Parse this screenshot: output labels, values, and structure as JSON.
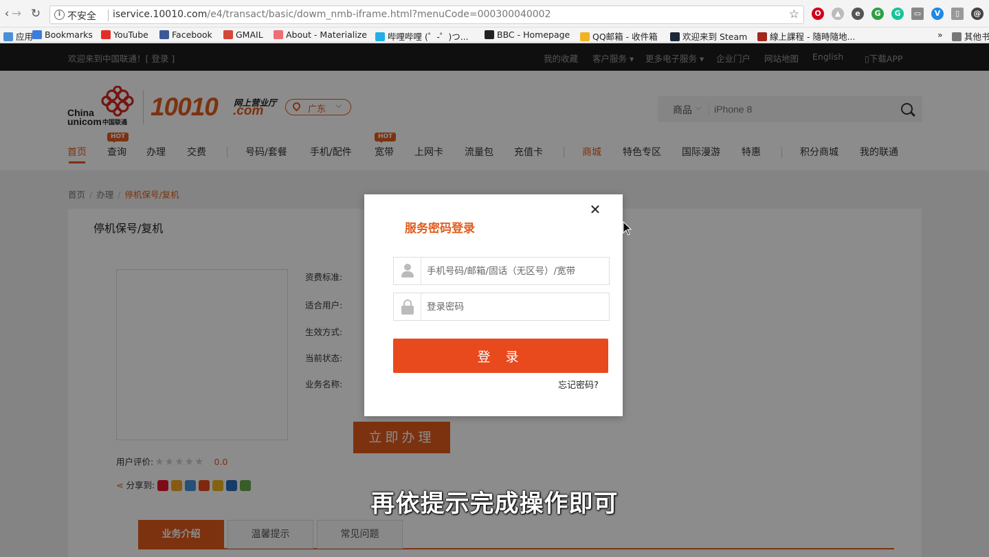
{
  "browser": {
    "insecure_label": "不安全",
    "url_host": "iservice.10010.com",
    "url_path": "/e4/transact/basic/dowm_nmb-iframe.html?menuCode=000300040002",
    "bookmarks": [
      {
        "label": "应用",
        "icon": "apps-icon",
        "color": "#4a90d9"
      },
      {
        "label": "Bookmarks",
        "icon": "star-icon",
        "color": "#3b7ddd"
      },
      {
        "label": "YouTube",
        "icon": "youtube-icon",
        "color": "#e52d27"
      },
      {
        "label": "Facebook",
        "icon": "facebook-icon",
        "color": "#3b5998"
      },
      {
        "label": "GMAIL",
        "icon": "gmail-icon",
        "color": "#d44638"
      },
      {
        "label": "About - Materialize",
        "icon": "materialize-icon",
        "color": "#ee6e73"
      },
      {
        "label": "哔哩哔哩 (゜-゜)つ...",
        "icon": "bilibili-icon",
        "color": "#23ade5"
      },
      {
        "label": "BBC - Homepage",
        "icon": "bbc-icon",
        "color": "#222222"
      },
      {
        "label": "QQ邮箱 - 收件箱",
        "icon": "qq-icon",
        "color": "#f0b323"
      },
      {
        "label": "欢迎来到 Steam",
        "icon": "steam-icon",
        "color": "#1b2838"
      },
      {
        "label": "線上課程 - 隨時隨地...",
        "icon": "udemy-icon",
        "color": "#a0281c"
      },
      {
        "label": "其他书",
        "icon": "folder-icon",
        "color": "#777777"
      }
    ]
  },
  "site": {
    "welcome": "欢迎来到中国联通！[ 登录 ]",
    "top_links": [
      "我的收藏",
      "客户服务 ▾",
      "更多电子服务 ▾",
      "企业门户",
      "网站地图",
      "English",
      "下载APP"
    ],
    "logo": {
      "china": "China",
      "unicom": "unicom",
      "cn": "中国联通",
      "num": "10010",
      "wsyyt": "网上营业厅",
      "com": ".com"
    },
    "region": "广东",
    "search": {
      "category": "商品",
      "placeholder": "iPhone 8"
    },
    "nav": [
      {
        "label": "首页"
      },
      {
        "label": "查询",
        "hot": "HOT"
      },
      {
        "label": "办理"
      },
      {
        "label": "交费"
      },
      {
        "label": "号码/套餐"
      },
      {
        "label": "手机/配件"
      },
      {
        "label": "宽带",
        "hot": "HOT"
      },
      {
        "label": "上网卡"
      },
      {
        "label": "流量包"
      },
      {
        "label": "充值卡"
      },
      {
        "label": "商城"
      },
      {
        "label": "特色专区"
      },
      {
        "label": "国际漫游"
      },
      {
        "label": "特惠"
      },
      {
        "label": "积分商城"
      },
      {
        "label": "我的联通"
      }
    ],
    "breadcrumb": [
      "首页",
      "办理",
      "停机保号/复机"
    ]
  },
  "product": {
    "title": "停机保号/复机",
    "labels": [
      "资费标准:",
      "适合用户:",
      "生效方式:",
      "当前状态:",
      "业务名称:"
    ],
    "handle_button": "立即办理",
    "rating_label": "用户评价:",
    "rating_value": "0.0",
    "share_label": "分享到:",
    "tabs": [
      "业务介绍",
      "温馨提示",
      "常见问题"
    ]
  },
  "modal": {
    "title": "服务密码登录",
    "account_placeholder": "手机号码/邮箱/固话（无区号）/宽带",
    "password_placeholder": "登录密码",
    "login_button": "登 录",
    "forgot_link": "忘记密码?"
  },
  "caption": "再依提示完成操作即可",
  "colors": {
    "brand": "#e25b1c",
    "button": "#e8491d"
  }
}
